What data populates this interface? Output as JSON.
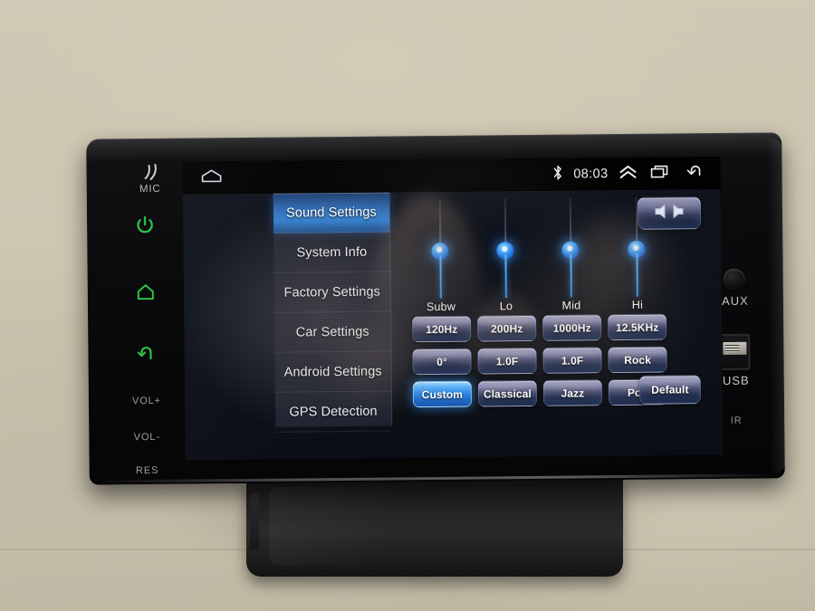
{
  "device": {
    "left_bezel": {
      "mic_label": "MIC",
      "mic_icon": "sound-waves-icon",
      "power_icon": "power-icon",
      "home_icon": "home-icon",
      "back_icon": "back-arrow-icon",
      "vol_up_label": "VOL+",
      "vol_down_label": "VOL-",
      "reset_label": "RES"
    },
    "right_bezel": {
      "aux_label": "AUX",
      "aux_icon": "aux-jack-icon",
      "usb_label": "USB",
      "usb_icon": "usb-port-icon",
      "ir_label": "IR"
    }
  },
  "statusbar": {
    "home_icon": "home-outline-icon",
    "bluetooth_icon": "bluetooth-icon",
    "time": "08:03",
    "expand_icon": "double-chevron-up-icon",
    "recents_icon": "recent-apps-icon",
    "back_icon": "back-arrow-icon"
  },
  "sidebar": {
    "items": [
      {
        "label": "Sound Settings",
        "selected": true
      },
      {
        "label": "System Info",
        "selected": false
      },
      {
        "label": "Factory Settings",
        "selected": false
      },
      {
        "label": "Car Settings",
        "selected": false
      },
      {
        "label": "Android Settings",
        "selected": false
      },
      {
        "label": "GPS Detection",
        "selected": false
      }
    ]
  },
  "equalizer": {
    "balance_icon": "balance-fader-icon",
    "sliders": [
      {
        "label": "Subw"
      },
      {
        "label": "Lo"
      },
      {
        "label": "Mid"
      },
      {
        "label": "Hi"
      }
    ],
    "frequency_row": [
      {
        "label": "120Hz",
        "active": false
      },
      {
        "label": "200Hz",
        "active": false
      },
      {
        "label": "1000Hz",
        "active": false
      },
      {
        "label": "12.5KHz",
        "active": false
      }
    ],
    "value_row": [
      {
        "label": "0°",
        "active": false
      },
      {
        "label": "1.0F",
        "active": false
      },
      {
        "label": "1.0F",
        "active": false
      },
      {
        "label": "Rock",
        "active": false
      }
    ],
    "preset_row": [
      {
        "label": "Custom",
        "active": true
      },
      {
        "label": "Classical",
        "active": false
      },
      {
        "label": "Jazz",
        "active": false
      },
      {
        "label": "Pop",
        "active": false
      }
    ],
    "default_button": {
      "label": "Default",
      "active": false
    }
  },
  "colors": {
    "accent_blue": "#2f7fd0",
    "slider_blue": "#3f9df2",
    "hw_green": "#2fbf4a",
    "button_face": "#8f90b0",
    "screen_bg": "#0a0e16"
  }
}
